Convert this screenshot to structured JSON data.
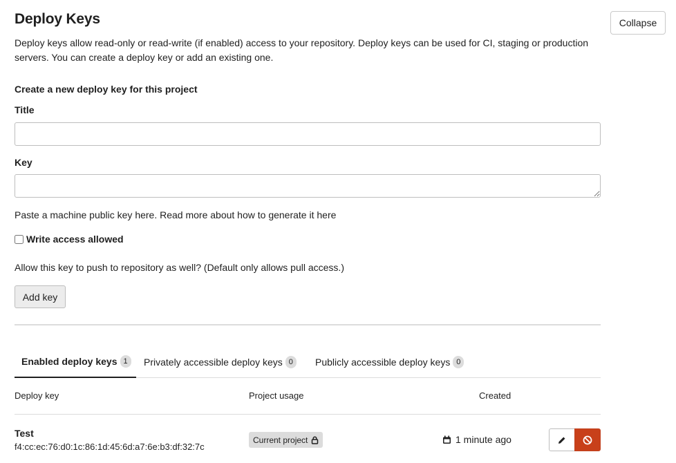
{
  "header": {
    "title": "Deploy Keys",
    "collapse_label": "Collapse",
    "description": "Deploy keys allow read-only or read-write (if enabled) access to your repository. Deploy keys can be used for CI, staging or production servers. You can create a deploy key or add an existing one."
  },
  "form": {
    "subheading": "Create a new deploy key for this project",
    "title_label": "Title",
    "title_value": "",
    "key_label": "Key",
    "key_value": "",
    "hint_text": "Paste a machine public key here. Read more about how to generate it ",
    "hint_link": "here",
    "write_access_label": "Write access allowed",
    "write_access_checked": false,
    "write_access_help": "Allow this key to push to repository as well? (Default only allows pull access.)",
    "add_button_label": "Add key"
  },
  "tabs": [
    {
      "label": "Enabled deploy keys",
      "count": "1",
      "active": true
    },
    {
      "label": "Privately accessible deploy keys",
      "count": "0",
      "active": false
    },
    {
      "label": "Publicly accessible deploy keys",
      "count": "0",
      "active": false
    }
  ],
  "table": {
    "headers": {
      "deploy_key": "Deploy key",
      "project_usage": "Project usage",
      "created": "Created"
    },
    "rows": [
      {
        "title": "Test",
        "fingerprint": "f4:cc:ec:76:d0:1c:86:1d:45:6d:a7:6e:b3:df:32:7c",
        "usage": "Current project",
        "usage_icon": "lock-icon",
        "created": "1 minute ago",
        "created_icon": "calendar-icon",
        "edit_icon": "pencil-icon",
        "remove_icon": "remove-icon"
      }
    ]
  },
  "colors": {
    "danger": "#c8401a",
    "badge_bg": "#dcdcdc",
    "text": "#1f1f1f"
  }
}
